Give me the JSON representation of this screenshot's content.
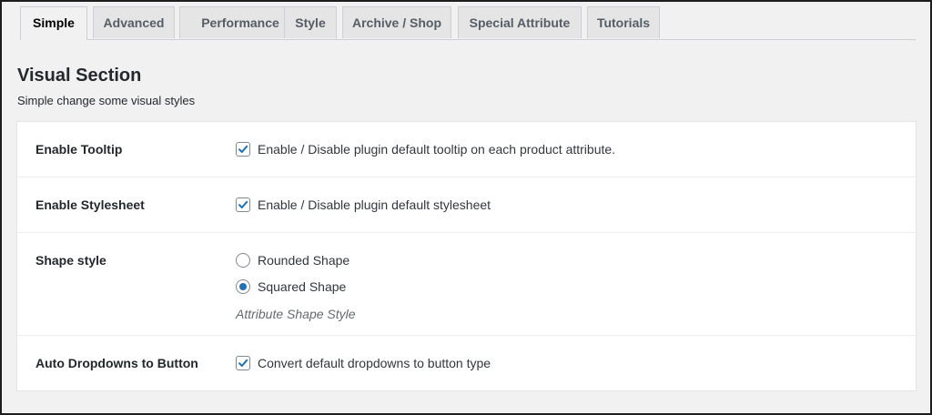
{
  "tabs": [
    {
      "label": "Simple",
      "active": true
    },
    {
      "label": "Advanced",
      "active": false
    },
    {
      "label": "Performance",
      "active": false
    },
    {
      "label": "Style",
      "active": false
    },
    {
      "label": "Archive / Shop",
      "active": false
    },
    {
      "label": "Special Attribute",
      "active": false
    },
    {
      "label": "Tutorials",
      "active": false
    }
  ],
  "section": {
    "title": "Visual Section",
    "description": "Simple change some visual styles"
  },
  "settings": {
    "tooltip": {
      "label": "Enable Tooltip",
      "option_label": "Enable / Disable plugin default tooltip on each product attribute.",
      "checked": true
    },
    "stylesheet": {
      "label": "Enable Stylesheet",
      "option_label": "Enable / Disable plugin default stylesheet",
      "checked": true
    },
    "shape": {
      "label": "Shape style",
      "options": [
        {
          "label": "Rounded Shape",
          "selected": false
        },
        {
          "label": "Squared Shape",
          "selected": true
        }
      ],
      "hint": "Attribute Shape Style"
    },
    "dropdowns": {
      "label": "Auto Dropdowns to Button",
      "option_label": "Convert default dropdowns to button type",
      "checked": true
    }
  },
  "colors": {
    "accent": "#2271b1",
    "background": "#f1f1f1",
    "panel": "#ffffff"
  },
  "icons": {
    "checkbox": "checkmark-icon",
    "radio": "radio-dot-icon"
  }
}
